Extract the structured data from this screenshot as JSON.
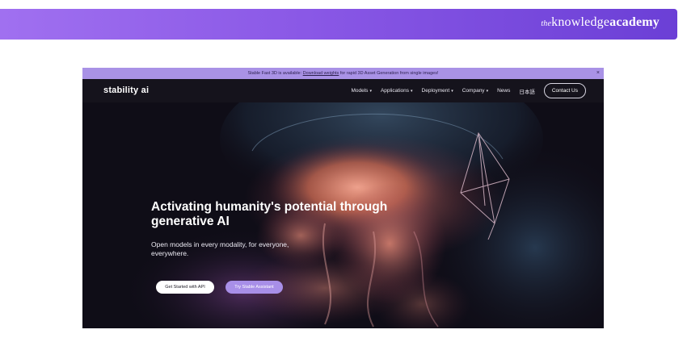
{
  "brand": {
    "prefix": "the",
    "word1": "knowledge",
    "word2": "academy"
  },
  "announcement": {
    "text_before": "Stable Fast 3D is available: ",
    "link": "Download weights",
    "text_after": " for rapid 3D Asset Generation from single images!",
    "close": "×"
  },
  "nav": {
    "logo": "stability ai",
    "items": [
      {
        "label": "Models"
      },
      {
        "label": "Applications"
      },
      {
        "label": "Deployment"
      },
      {
        "label": "Company"
      },
      {
        "label": "News"
      }
    ],
    "language": "日本語",
    "contact": "Contact Us"
  },
  "hero": {
    "headline": "Activating humanity's potential through generative AI",
    "subhead": "Open models in every modality, for everyone, everywhere.",
    "primary_button": "Get Started with API",
    "secondary_button": "Try Stable Assistant"
  },
  "colors": {
    "banner_start": "#a070f0",
    "banner_end": "#6b3fd6",
    "hero_background": "#0f0d17",
    "accent": "#a88fe8"
  }
}
